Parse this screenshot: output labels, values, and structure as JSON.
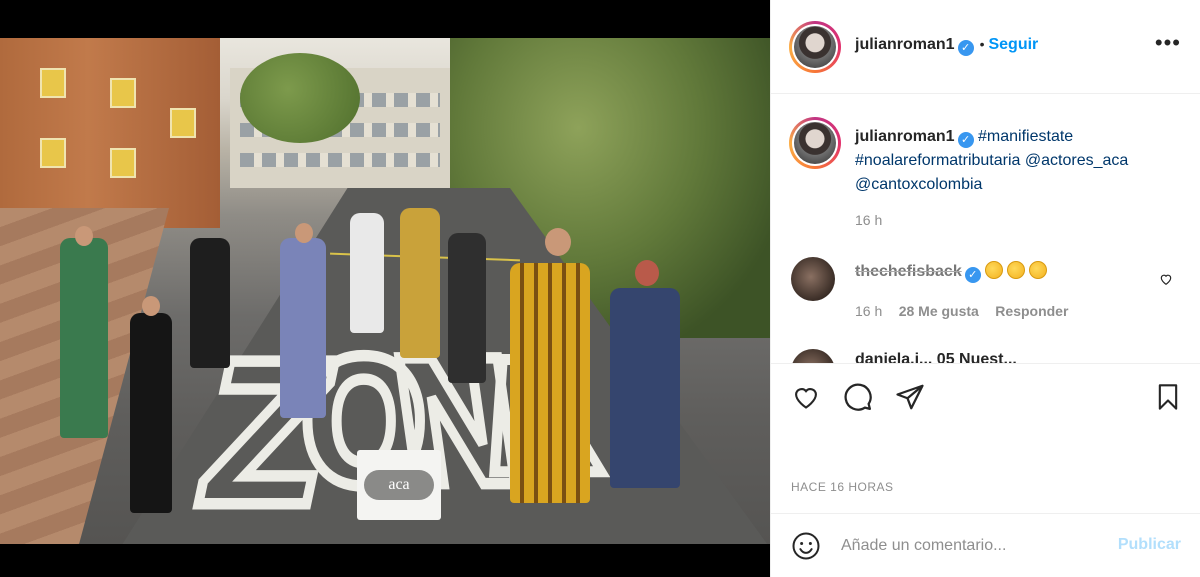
{
  "post": {
    "image": {
      "sign_text": "aca",
      "road_letters": [
        "Z",
        "O",
        "N",
        "A"
      ]
    },
    "header": {
      "username": "julianroman1",
      "separator": "•",
      "follow_label": "Seguir",
      "more_icon": "more-options-icon"
    },
    "caption": {
      "username": "julianroman1",
      "parts": [
        "#manifiestate",
        "#noalareformatributaria",
        "@actores_aca",
        "@cantoxcolombia"
      ],
      "time": "16 h"
    },
    "comments": [
      {
        "username": "thechefisback",
        "time": "16 h",
        "likes": "28 Me gusta",
        "reply_label": "Responder"
      },
      {
        "partial_text": "daniela.j... 05 Nuest..."
      }
    ],
    "actions": {
      "like_icon": "heart-icon",
      "comment_icon": "comment-icon",
      "share_icon": "send-icon",
      "save_icon": "bookmark-icon"
    },
    "date_label": "HACE 16 HORAS",
    "add_comment": {
      "emoji_icon": "emoji-icon",
      "placeholder": "Añade un comentario...",
      "publish_label": "Publicar"
    }
  },
  "colors": {
    "link": "#00376b",
    "follow": "#0095f6",
    "verified": "#3897f0",
    "publish_disabled": "#b2dffc"
  }
}
